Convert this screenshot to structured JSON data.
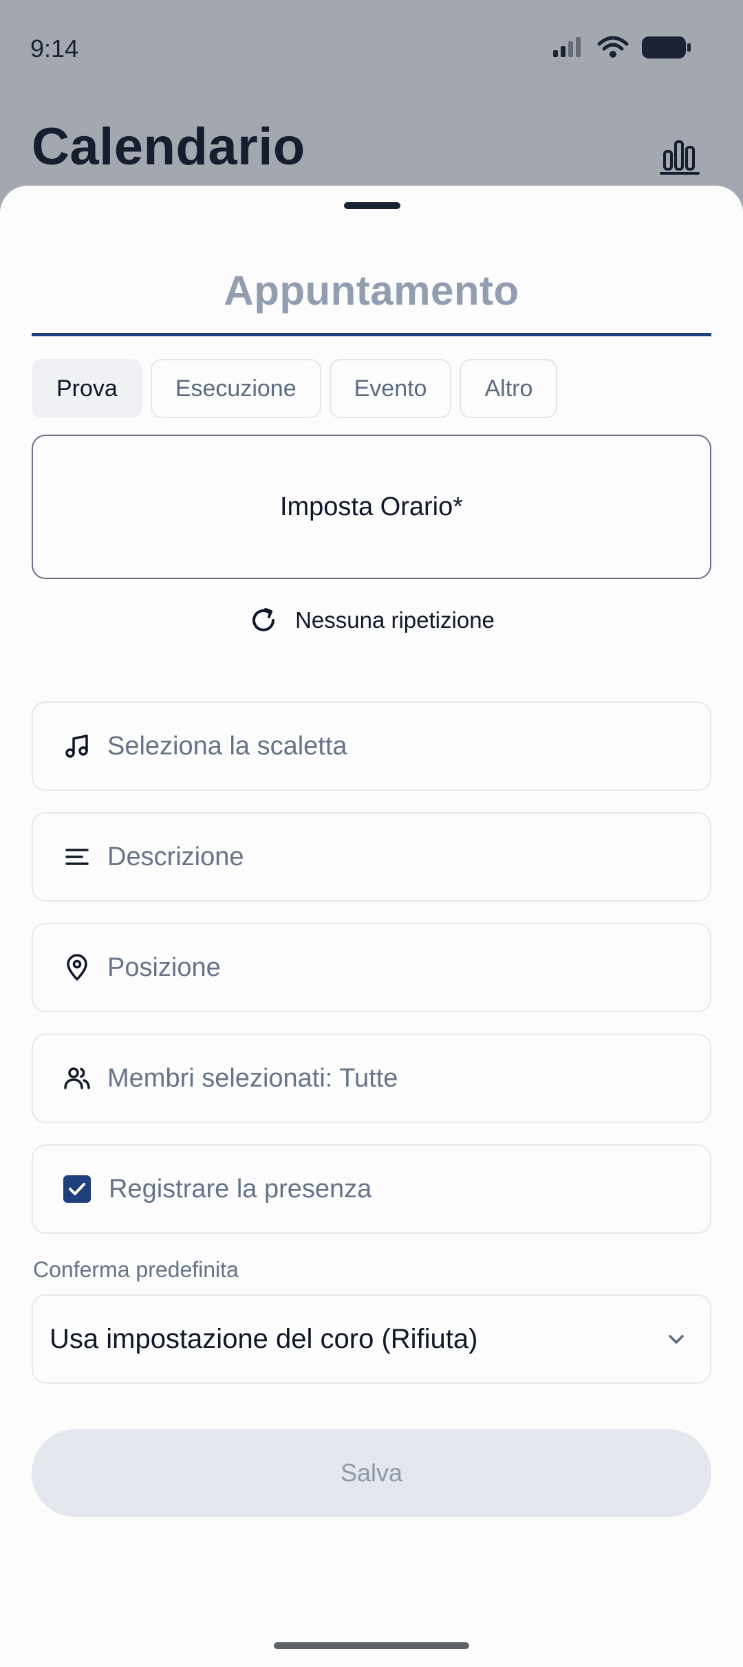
{
  "status_bar": {
    "time": "9:14"
  },
  "header": {
    "title": "Calendario"
  },
  "sheet": {
    "title": "Appuntamento",
    "chips": [
      {
        "label": "Prova",
        "active": true
      },
      {
        "label": "Esecuzione",
        "active": false
      },
      {
        "label": "Evento",
        "active": false
      },
      {
        "label": "Altro",
        "active": false
      }
    ],
    "time_button": "Imposta Orario*",
    "repeat_label": "Nessuna ripetizione",
    "fields": {
      "setlist": "Seleziona la scaletta",
      "description": "Descrizione",
      "location": "Posizione",
      "members": "Membri selezionati: Tutte",
      "attendance": "Registrare la presenza"
    },
    "attendance_checked": true,
    "default_confirmation_label": "Conferma predefinita",
    "default_confirmation_value": "Usa impostazione del coro (Rifiuta)",
    "save_label": "Salva"
  },
  "colors": {
    "accent": "#1e3e7c",
    "overlay": "#a2a7b0",
    "title_muted": "#929db0"
  },
  "icons": {
    "stats": "bar-chart-icon",
    "repeat": "refresh-icon",
    "setlist": "music-note-icon",
    "description": "text-lines-icon",
    "location": "map-pin-icon",
    "members": "users-icon",
    "select": "chevron-down-icon"
  }
}
